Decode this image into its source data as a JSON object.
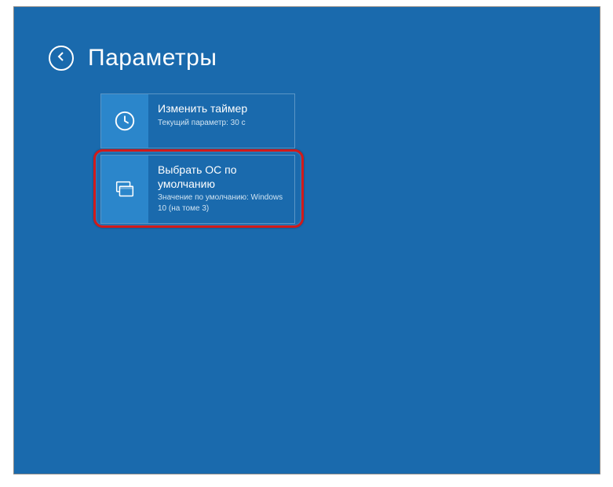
{
  "header": {
    "title": "Параметры"
  },
  "tiles": {
    "timer": {
      "title": "Изменить таймер",
      "subtitle": "Текущий параметр: 30 с"
    },
    "defaultOs": {
      "title": "Выбрать ОС по умолчанию",
      "subtitle": "Значение по умолчанию: Windows 10 (на томе 3)"
    }
  }
}
